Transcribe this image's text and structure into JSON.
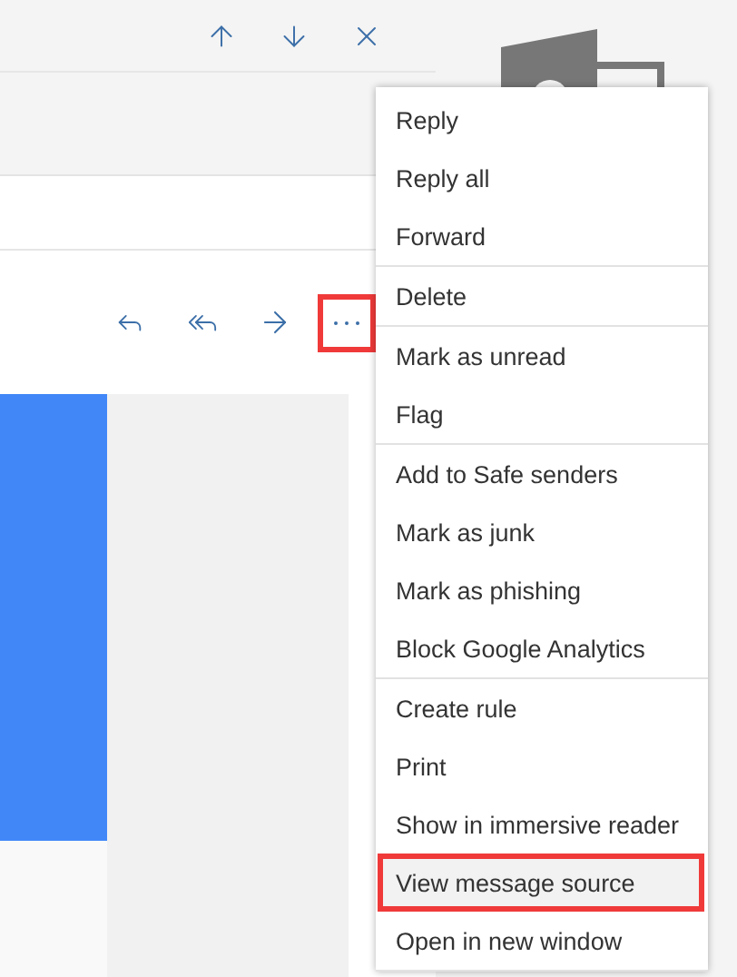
{
  "toolbar": [
    {
      "kind": "up"
    },
    {
      "kind": "down"
    },
    {
      "kind": "close"
    }
  ],
  "message_actions": [
    {
      "kind": "reply",
      "annotated": false
    },
    {
      "kind": "reply_all",
      "annotated": false
    },
    {
      "kind": "forward",
      "annotated": false
    },
    {
      "kind": "more",
      "annotated": true
    }
  ],
  "menu": {
    "groups": [
      {
        "items": [
          {
            "label": "Reply",
            "selected": false,
            "annotated": false
          },
          {
            "label": "Reply all",
            "selected": false,
            "annotated": false
          },
          {
            "label": "Forward",
            "selected": false,
            "annotated": false
          }
        ]
      },
      {
        "items": [
          {
            "label": "Delete",
            "selected": false,
            "annotated": false
          }
        ]
      },
      {
        "items": [
          {
            "label": "Mark as unread",
            "selected": false,
            "annotated": false
          },
          {
            "label": "Flag",
            "selected": false,
            "annotated": false
          }
        ]
      },
      {
        "items": [
          {
            "label": "Add to Safe senders",
            "selected": false,
            "annotated": false
          },
          {
            "label": "Mark as junk",
            "selected": false,
            "annotated": false
          },
          {
            "label": "Mark as phishing",
            "selected": false,
            "annotated": false
          },
          {
            "label": "Block Google Analytics",
            "selected": false,
            "annotated": false
          }
        ]
      },
      {
        "items": [
          {
            "label": "Create rule",
            "selected": false,
            "annotated": false
          },
          {
            "label": "Print",
            "selected": false,
            "annotated": false
          },
          {
            "label": "Show in immersive reader",
            "selected": false,
            "annotated": false
          },
          {
            "label": "View message source",
            "selected": true,
            "annotated": true
          },
          {
            "label": "Open in new window",
            "selected": false,
            "annotated": false
          }
        ]
      }
    ]
  }
}
